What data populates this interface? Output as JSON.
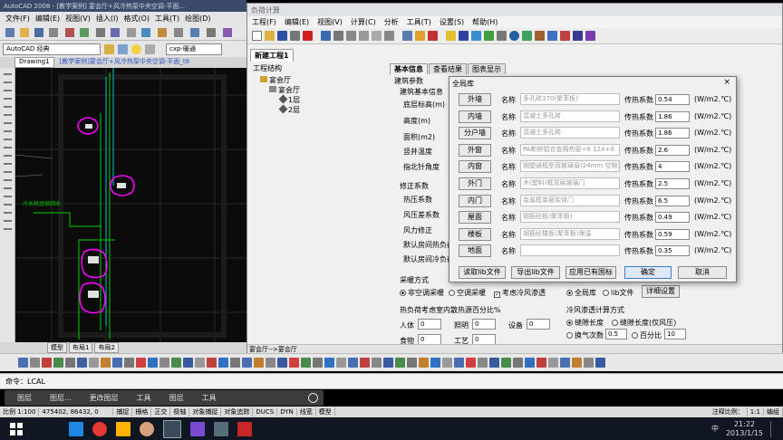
{
  "autocad": {
    "title": "AutoCAD 2008 - [教学案例] 宴会厅+风冷热泵中央空调-平面...",
    "menu": [
      "文件(F)",
      "编辑(E)",
      "视图(V)",
      "插入(I)",
      "格式(O)",
      "工具(T)",
      "绘图(D)"
    ],
    "workspace": "AutoCAD 经典",
    "layer_combo": "cxp-暖通",
    "tabs": [
      "Drawing1",
      "[教学案例]宴会厅+风冷热泵中央空调-平面_t8"
    ],
    "layout_tabs": [
      "模型",
      "布局1",
      "布局2"
    ],
    "cad_label": "冷水机组供回水",
    "command_line": "命令：LCAL",
    "status": [
      "比例 1:100",
      "475402, 86432, 0",
      "捕捉",
      "栅格",
      "正交",
      "极轴",
      "对象捕捉",
      "对象追踪",
      "DUCS",
      "DYN",
      "线宽",
      "模型"
    ],
    "status_right": [
      "注释比例：",
      "1:1",
      "编组"
    ]
  },
  "floatbar": [
    "图层",
    "图层...",
    "更改图层",
    "工具",
    "图层",
    "工具"
  ],
  "app": {
    "title": "负荷计算",
    "menu": [
      "工程(F)",
      "编辑(E)",
      "视图(V)",
      "计算(C)",
      "分析",
      "工具(T)",
      "设置(S)",
      "帮助(H)"
    ],
    "doc_tab": "新建工程1",
    "tree": {
      "header": "工程结构",
      "root": "宴会厅",
      "child": "宴会厅",
      "floors": [
        "1层",
        "2层"
      ]
    },
    "right_tabs": [
      "基本信息",
      "查看结果",
      "图表显示"
    ],
    "labels": {
      "building_params": "建筑参数",
      "building_basic": "建筑基本信息",
      "floor_height": "底层标高(m)",
      "height": "高度(m)",
      "area": "面积(m2)",
      "shaft_temp": "竖井温度",
      "north_angle": "指北针角度",
      "correction": "修正系数",
      "heat_coef": "热压系数",
      "wind_coef": "风压差系数",
      "wind_correct": "风力修正",
      "default_room_heat": "默认房间热负荷",
      "default_room_cool": "默认房间冷负荷",
      "heating_mode": "采暖方式",
      "heat_percent": "热负荷考虑室内散热源百分比%",
      "people": "人体",
      "lighting": "照明",
      "equipment": "设备",
      "food": "食物",
      "process": "工艺",
      "infiltration": "冷风渗透计算方式",
      "gap_len": "缝隙长度",
      "gap_len_wind": "缝隙长度(仅风压)",
      "air_change": "换气次数",
      "air_change_val": "0.5",
      "percent": "百分比",
      "percent_val": "10"
    },
    "heating_options": [
      "非空调采暖",
      "空调采暖",
      "考虑冷风渗透"
    ],
    "source_options": [
      "全局库",
      "lib文件"
    ],
    "settings_btn": "详细设置",
    "bottom_inputs": [
      "0",
      "0",
      "0",
      "0",
      "0"
    ],
    "status": "宴会厅-->宴会厅"
  },
  "dialog": {
    "title": "全局库",
    "close": "×",
    "name_label": "名称",
    "coef_label": "传热系数",
    "unit": "(W/m2.℃)",
    "rows": [
      {
        "btn": "外墙",
        "name": "多孔砖370(聚苯板)",
        "value": "0.54"
      },
      {
        "btn": "内墙",
        "name": "混凝土多孔砖",
        "value": "1.86"
      },
      {
        "btn": "分户墙",
        "name": "混凝土多孔砖",
        "value": "1.86"
      },
      {
        "btn": "外窗",
        "name": "PA断桥铝合金隔热窗+6 12A+6",
        "value": "2.6"
      },
      {
        "btn": "内窗",
        "name": "钢塑通框型双玻璃窗(24mm 空隙)",
        "value": "4"
      },
      {
        "btn": "外门",
        "name": "木(塑料)框双层玻璃门",
        "value": "2.5"
      },
      {
        "btn": "内门",
        "name": "金属框单层实体门",
        "value": "6.5"
      },
      {
        "btn": "屋面",
        "name": "钢筋砼板(聚苯板)",
        "value": "0.49"
      },
      {
        "btn": "楼板",
        "name": "钢筋砼楼板(聚苯板)保温",
        "value": "0.59"
      },
      {
        "btn": "地面",
        "name": "",
        "value": "0.35"
      }
    ],
    "footer": [
      "读取lib文件",
      "导出lib文件",
      "应用已有国标",
      "确定",
      "取消"
    ]
  },
  "taskbar": {
    "time": "21:22",
    "date": "2013/1/15",
    "lang": "中"
  },
  "colors": {
    "magenta": "#ff00ff",
    "green": "#00d000",
    "cyan": "#00c8c8",
    "title_bar": "#3b4a6b"
  }
}
